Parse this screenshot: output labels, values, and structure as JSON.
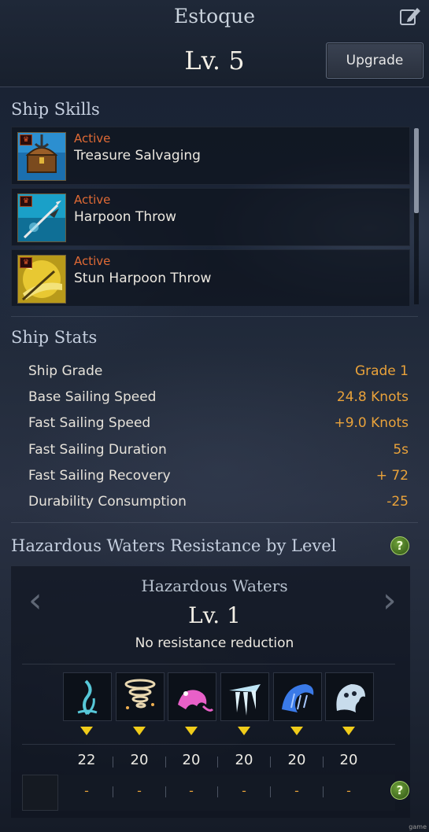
{
  "header": {
    "ship_name": "Estoque",
    "level": "Lv. 5",
    "upgrade_label": "Upgrade",
    "edit_icon": "edit-icon"
  },
  "ship_skills": {
    "title": "Ship Skills",
    "items": [
      {
        "status": "Active",
        "name": "Treasure Salvaging",
        "icon": "treasure-chest-icon",
        "badge_icon": "crown-badge-icon"
      },
      {
        "status": "Active",
        "name": "Harpoon Throw",
        "icon": "harpoon-icon",
        "badge_icon": "crown-badge-icon"
      },
      {
        "status": "Active",
        "name": "Stun Harpoon Throw",
        "icon": "stun-harpoon-icon",
        "badge_icon": "crown-badge-icon"
      }
    ]
  },
  "ship_stats": {
    "title": "Ship Stats",
    "rows": [
      {
        "label": "Ship Grade",
        "value": "Grade 1"
      },
      {
        "label": "Base Sailing Speed",
        "value": "24.8 Knots"
      },
      {
        "label": "Fast Sailing Speed",
        "value": "+9.0 Knots"
      },
      {
        "label": "Fast Sailing Duration",
        "value": "5s"
      },
      {
        "label": "Fast Sailing Recovery",
        "value": "+ 72"
      },
      {
        "label": "Durability Consumption",
        "value": "-25"
      }
    ]
  },
  "hazardous": {
    "title": "Hazardous Waters Resistance by Level",
    "subtitle": "Hazardous Waters",
    "level": "Lv. 1",
    "description": "No resistance reduction",
    "types": [
      {
        "icon": "seaweed-icon",
        "value": "22",
        "bottom": "-"
      },
      {
        "icon": "tornado-icon",
        "value": "20",
        "bottom": "-"
      },
      {
        "icon": "sea-creature-icon",
        "value": "20",
        "bottom": "-"
      },
      {
        "icon": "ice-shards-icon",
        "value": "20",
        "bottom": "-"
      },
      {
        "icon": "storm-wave-icon",
        "value": "20",
        "bottom": "-"
      },
      {
        "icon": "ghost-icon",
        "value": "20",
        "bottom": "-"
      }
    ]
  },
  "colors": {
    "accent_orange": "#e9a23a",
    "active_red": "#e06a35",
    "warning_yellow": "#f0cc1a"
  },
  "watermark": "game"
}
